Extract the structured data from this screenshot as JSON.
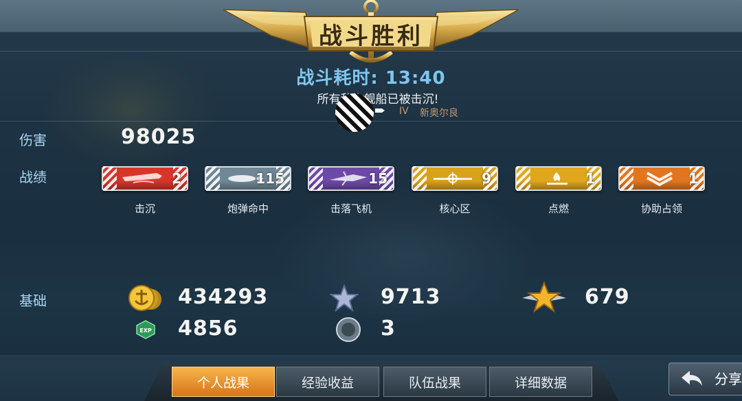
{
  "header": {
    "title": "战斗胜利",
    "battle_time": "战斗耗时: 13:40",
    "message": "所有敌方舰船已被击沉!",
    "ship_tier": "IV",
    "ship_name": "新奥尔良"
  },
  "damage": {
    "label": "伤害",
    "value": "98025"
  },
  "achievements": {
    "label": "战绩",
    "items": [
      {
        "value": "2",
        "label": "击沉",
        "color": "#d8352a",
        "icon": "ship-sinking-icon"
      },
      {
        "value": "115",
        "label": "炮弹命中",
        "color": "#6f8797",
        "icon": "shell-hit-icon"
      },
      {
        "value": "15",
        "label": "击落飞机",
        "color": "#6d4aa8",
        "icon": "plane-shot-icon"
      },
      {
        "value": "9",
        "label": "核心区",
        "color": "#d9a21b",
        "icon": "citadel-icon"
      },
      {
        "value": "1",
        "label": "点燃",
        "color": "#e0a61c",
        "icon": "fire-icon"
      },
      {
        "value": "1",
        "label": "协助占领",
        "color": "#e27620",
        "icon": "capture-assist-icon"
      }
    ]
  },
  "base": {
    "label": "基础",
    "gold": "434293",
    "star_xp": "9713",
    "rank_points": "679",
    "exp": "4856",
    "exp_icon_text": "EXP",
    "medals": "3"
  },
  "tabs": [
    "个人战果",
    "经验收益",
    "队伍战果",
    "详细数据"
  ],
  "active_tab": 0,
  "share_label": "分享"
}
